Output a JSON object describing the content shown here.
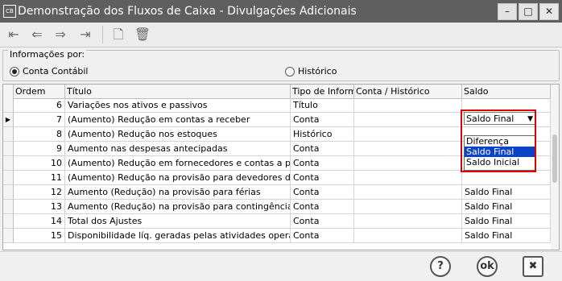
{
  "window": {
    "app_icon": "CB",
    "title": "Demonstração dos Fluxos de Caixa - Divulgações Adicionais",
    "controls": {
      "minimize": "–",
      "maximize": "□",
      "close": "✕"
    }
  },
  "toolbar": {
    "first_icon": "⇤",
    "prev_icon": "⇐",
    "next_icon": "⇒",
    "last_icon": "⇥",
    "new_icon": "🗋",
    "delete_icon": "🗑"
  },
  "info_group": {
    "legend": "Informações por:",
    "options": [
      {
        "label": "Conta Contábil",
        "selected": true
      },
      {
        "label": "Histórico",
        "selected": false
      }
    ]
  },
  "grid": {
    "columns": [
      "Ordem",
      "Título",
      "Tipo de Informa",
      "Conta / Histórico",
      "Saldo"
    ],
    "rows": [
      {
        "ordem": "6",
        "titulo": "Variações nos ativos e passivos",
        "tipo": "Título",
        "conta": "",
        "saldo": ""
      },
      {
        "ordem": "7",
        "titulo": "(Aumento) Redução em contas a receber",
        "tipo": "Conta",
        "conta": "",
        "saldo": "Saldo Final",
        "current": true
      },
      {
        "ordem": "8",
        "titulo": "(Aumento) Redução nos estoques",
        "tipo": "Histórico",
        "conta": "",
        "saldo": ""
      },
      {
        "ordem": "9",
        "titulo": "Aumento nas despesas antecipadas",
        "tipo": "Conta",
        "conta": "",
        "saldo": ""
      },
      {
        "ordem": "10",
        "titulo": "(Aumento) Redução em fornecedores e contas a pagar",
        "tipo": "Conta",
        "conta": "",
        "saldo": ""
      },
      {
        "ordem": "11",
        "titulo": "(Aumento) Redução na provisão para devedores duvidosos",
        "tipo": "Conta",
        "conta": "",
        "saldo": ""
      },
      {
        "ordem": "12",
        "titulo": "Aumento (Redução) na provisão para férias",
        "tipo": "Conta",
        "conta": "",
        "saldo": "Saldo Final"
      },
      {
        "ordem": "13",
        "titulo": "Aumento (Redução) na provisão para contingências",
        "tipo": "Conta",
        "conta": "",
        "saldo": "Saldo Final"
      },
      {
        "ordem": "14",
        "titulo": "Total dos Ajustes",
        "tipo": "Conta",
        "conta": "",
        "saldo": "Saldo Final"
      },
      {
        "ordem": "15",
        "titulo": "Disponibilidade líq. geradas pelas atividades operacionais",
        "tipo": "Conta",
        "conta": "",
        "saldo": "Saldo Final"
      }
    ]
  },
  "saldo_dropdown": {
    "selected": "Saldo Final",
    "options": [
      "Diferença",
      "Saldo Final",
      "Saldo Inicial"
    ],
    "highlighted": "Saldo Final"
  },
  "footer": {
    "help_icon": "?",
    "ok_label": "ok",
    "cancel_icon": "✖"
  },
  "colors": {
    "title_bar": "#5f5f5f",
    "selection": "#0a43c8",
    "highlight_box": "#e10000"
  }
}
